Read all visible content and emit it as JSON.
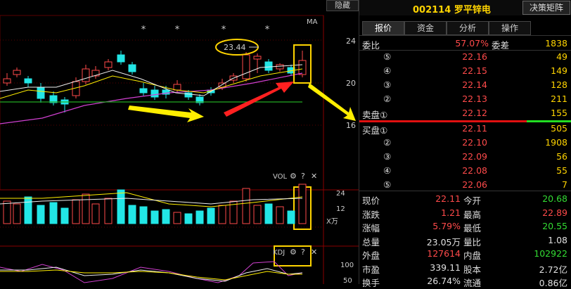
{
  "chart": {
    "hide_label": "隐藏",
    "ma_label": "MA",
    "price_axis": [
      "24",
      "20",
      "16"
    ],
    "high_annotation": "23.44",
    "stars": [
      "*",
      "*",
      "*",
      "*"
    ],
    "vol_label": "VOL",
    "vol_axis": [
      "24",
      "12"
    ],
    "vol_unit": "X万",
    "kdj_label": "KDJ",
    "kdj_axis": [
      "100",
      "50",
      "0"
    ],
    "panel_icons": [
      "gear-icon",
      "help-icon",
      "close-icon"
    ]
  },
  "header": {
    "code": "002114",
    "name": "罗平锌电",
    "decision_button": "决策矩阵"
  },
  "tabs": [
    {
      "label": "报价",
      "active": true
    },
    {
      "label": "资金",
      "active": false
    },
    {
      "label": "分析",
      "active": false
    },
    {
      "label": "操作",
      "active": false
    }
  ],
  "commission": {
    "ratio_label": "委比",
    "ratio_value": "57.07%",
    "diff_label": "委差",
    "diff_value": "1838"
  },
  "sell_orders": [
    {
      "idx": "⑤",
      "price": "22.16",
      "volume": "49"
    },
    {
      "idx": "④",
      "price": "22.15",
      "volume": "149"
    },
    {
      "idx": "③",
      "price": "22.14",
      "volume": "128"
    },
    {
      "idx": "②",
      "price": "22.13",
      "volume": "211"
    },
    {
      "label": "卖盘①",
      "price": "22.12",
      "volume": "155"
    }
  ],
  "buy_orders": [
    {
      "label": "买盘①",
      "price": "22.11",
      "volume": "505"
    },
    {
      "idx": "②",
      "price": "22.10",
      "volume": "1908"
    },
    {
      "idx": "③",
      "price": "22.09",
      "volume": "56"
    },
    {
      "idx": "④",
      "price": "22.08",
      "volume": "55"
    },
    {
      "idx": "⑤",
      "price": "22.06",
      "volume": "7"
    }
  ],
  "stats": [
    {
      "l1": "现价",
      "v1": "22.11",
      "c1": "red",
      "l2": "今开",
      "v2": "20.68",
      "c2": "green"
    },
    {
      "l1": "涨跌",
      "v1": "1.21",
      "c1": "red",
      "l2": "最高",
      "v2": "22.89",
      "c2": "red"
    },
    {
      "l1": "涨幅",
      "v1": "5.79%",
      "c1": "red",
      "l2": "最低",
      "v2": "20.55",
      "c2": "green"
    },
    {
      "l1": "总量",
      "v1": "23.05万",
      "c1": "white",
      "l2": "量比",
      "v2": "1.08",
      "c2": "white"
    },
    {
      "l1": "外盘",
      "v1": "127614",
      "c1": "red",
      "l2": "内盘",
      "v2": "102922",
      "c2": "green"
    },
    {
      "l1": "市盈",
      "v1": "339.11",
      "c1": "white",
      "l2": "股本",
      "v2": "2.72亿",
      "c2": "white"
    },
    {
      "l1": "换手",
      "v1": "26.74%",
      "c1": "white",
      "l2": "流通",
      "v2": "0.86亿",
      "c2": "white"
    }
  ],
  "colors": {
    "up": "#ff4a4a",
    "down": "#22e6e6",
    "gold": "#ffd400",
    "arrow_red": "#ff2020",
    "ma_yellow": "#ffee00"
  }
}
